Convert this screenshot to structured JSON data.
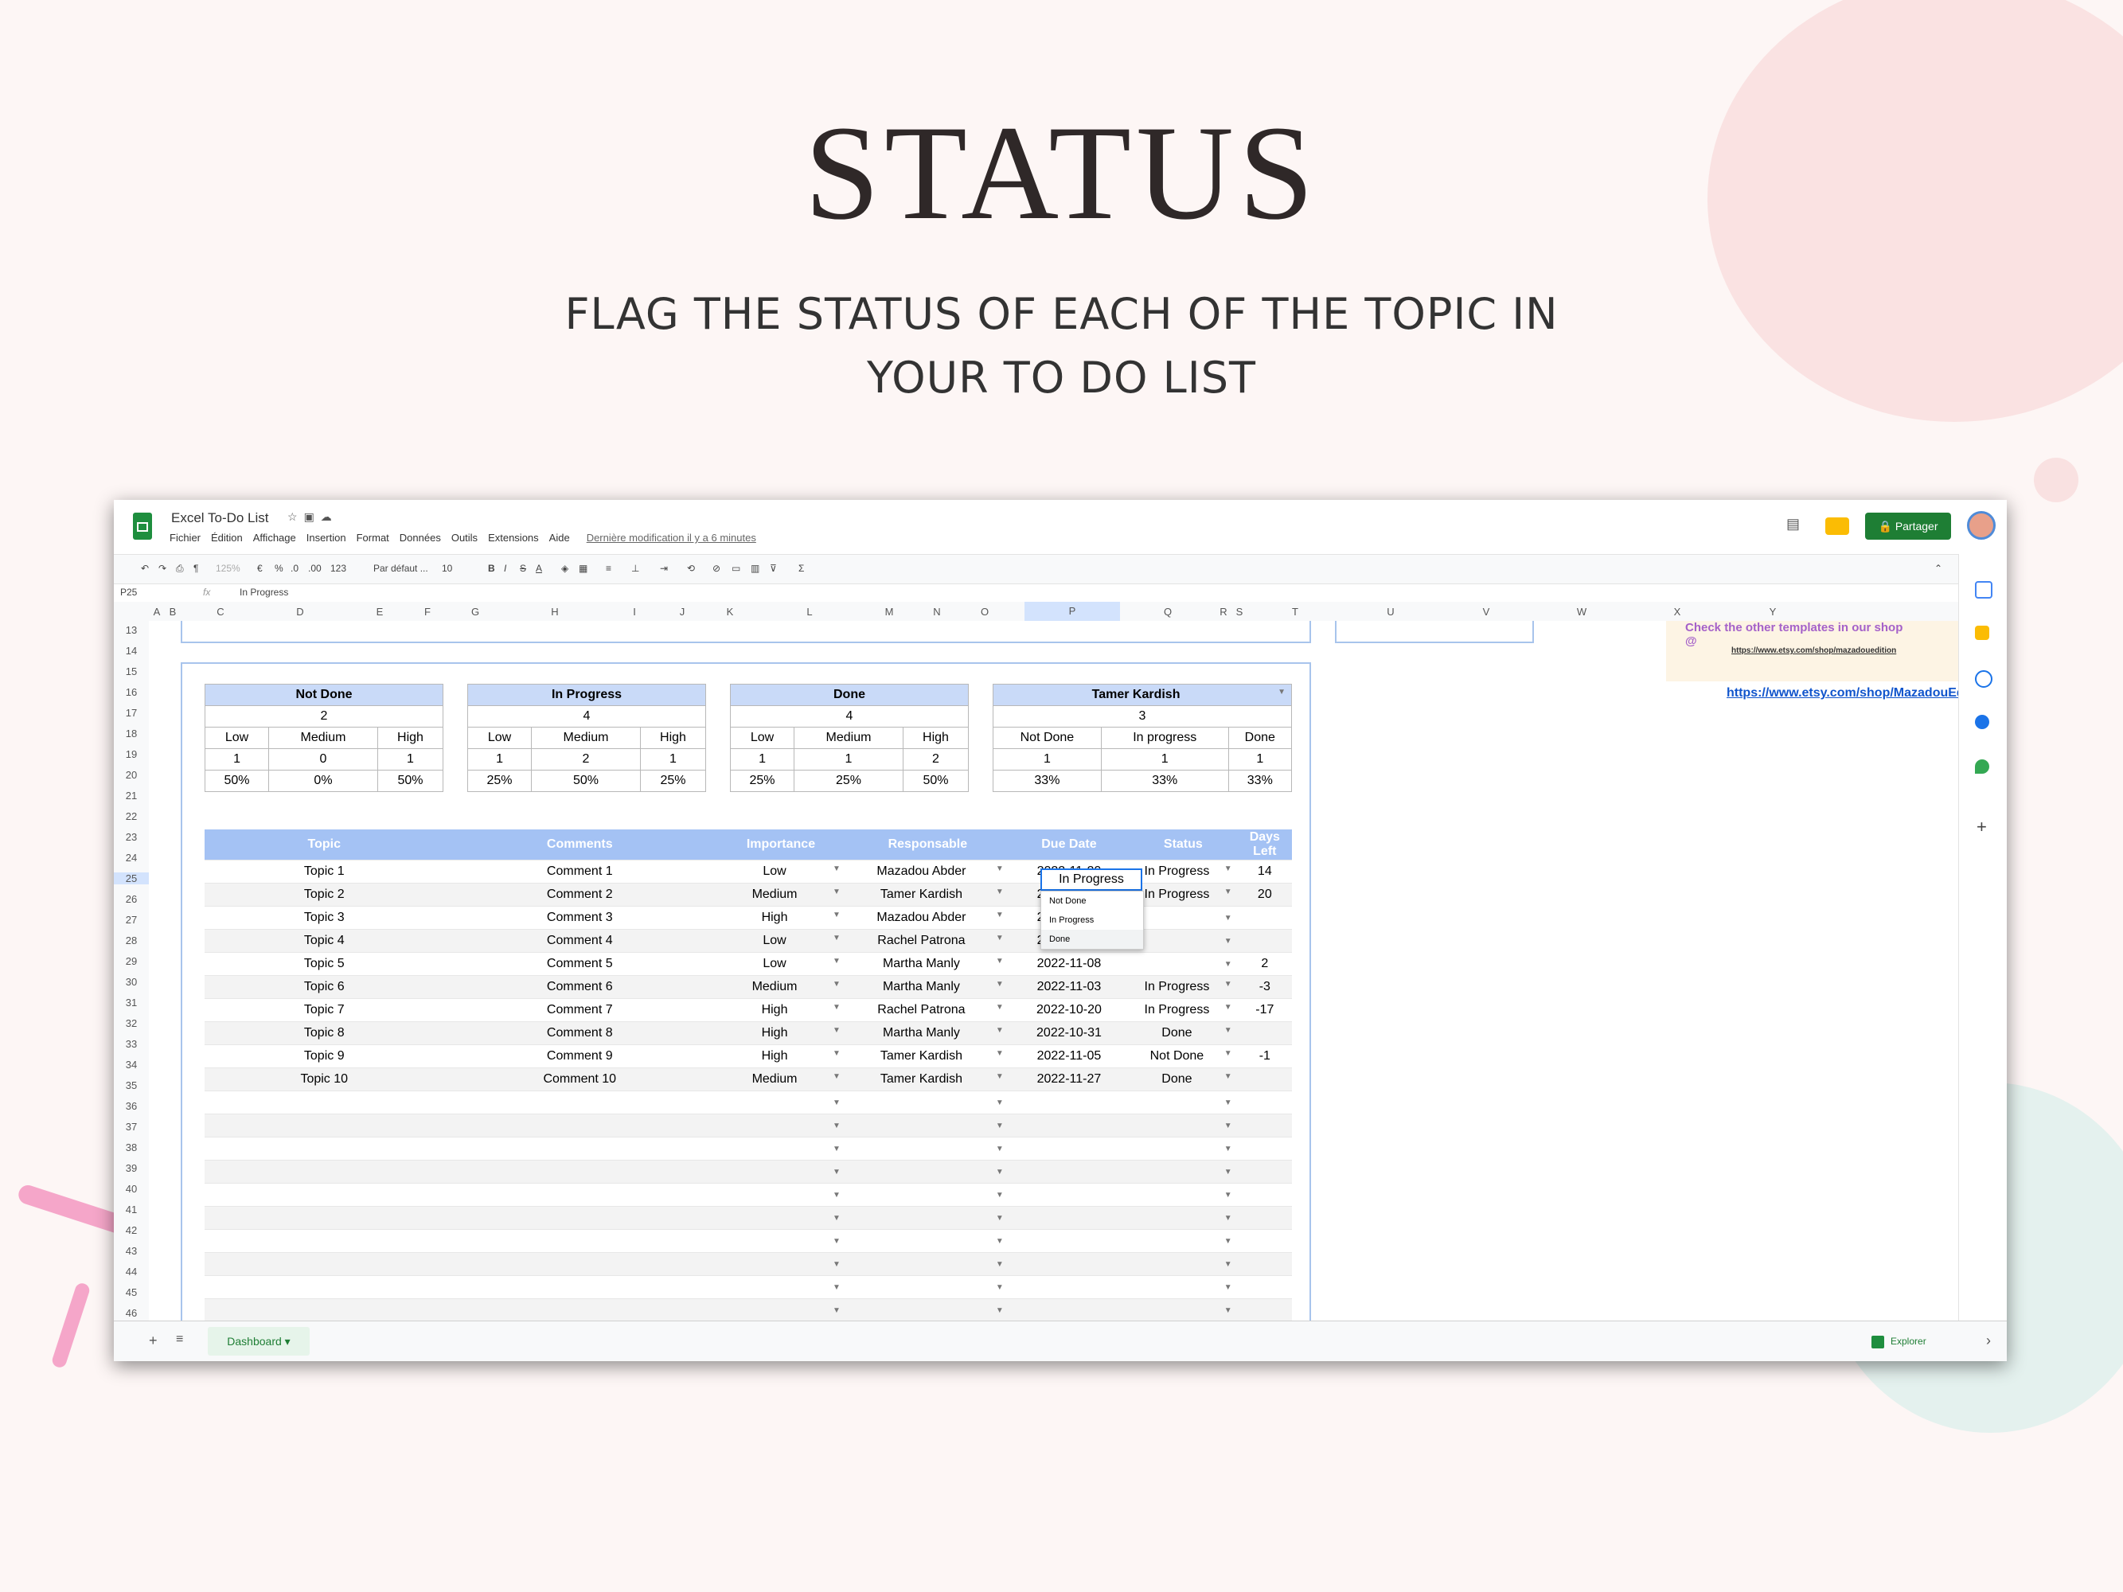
{
  "hero": {
    "title": "STATUS",
    "subtitle_line1": "FLAG THE STATUS OF EACH OF THE TOPIC IN",
    "subtitle_line2": "YOUR TO DO LIST"
  },
  "app": {
    "doc_title": "Excel To-Do List",
    "menu": [
      "Fichier",
      "Édition",
      "Affichage",
      "Insertion",
      "Format",
      "Données",
      "Outils",
      "Extensions",
      "Aide"
    ],
    "last_modified": "Dernière modification il y a 6 minutes",
    "share_label": "Partager",
    "cell_ref": "P25",
    "fx": "fx",
    "formula_value": "In Progress",
    "toolbar": {
      "zoom": "125%",
      "euro": "€",
      "percent": "%",
      "dec_less": ".0",
      "dec_more": ".00",
      "num_format": "123",
      "font": "Par défaut ...",
      "size": "10",
      "bold": "B",
      "italic": "I",
      "strike": "S",
      "text_color": "A"
    },
    "sheet_tab": "Dashboard",
    "explorer": "Explorer"
  },
  "columns": [
    "A",
    "B",
    "C",
    "D",
    "E",
    "F",
    "G",
    "H",
    "I",
    "J",
    "K",
    "L",
    "M",
    "N",
    "O",
    "P",
    "Q",
    "R",
    "S",
    "T",
    "U",
    "V",
    "W",
    "X",
    "Y"
  ],
  "rows": [
    "13",
    "14",
    "15",
    "16",
    "17",
    "18",
    "19",
    "20",
    "21",
    "22",
    "23",
    "24",
    "25",
    "26",
    "27",
    "28",
    "29",
    "30",
    "31",
    "32",
    "33",
    "34",
    "35",
    "36",
    "37",
    "38",
    "39",
    "40",
    "41",
    "42",
    "43",
    "44",
    "45",
    "46"
  ],
  "summary": [
    {
      "title": "Not Done",
      "total": "2",
      "labels": [
        "Low",
        "Medium",
        "High"
      ],
      "counts": [
        "1",
        "0",
        "1"
      ],
      "pcts": [
        "50%",
        "0%",
        "50%"
      ]
    },
    {
      "title": "In Progress",
      "total": "4",
      "labels": [
        "Low",
        "Medium",
        "High"
      ],
      "counts": [
        "1",
        "2",
        "1"
      ],
      "pcts": [
        "25%",
        "50%",
        "25%"
      ]
    },
    {
      "title": "Done",
      "total": "4",
      "labels": [
        "Low",
        "Medium",
        "High"
      ],
      "counts": [
        "1",
        "1",
        "2"
      ],
      "pcts": [
        "25%",
        "25%",
        "50%"
      ]
    },
    {
      "title": "Tamer Kardish",
      "total": "3",
      "labels": [
        "Not Done",
        "In progress",
        "Done"
      ],
      "counts": [
        "1",
        "1",
        "1"
      ],
      "pcts": [
        "33%",
        "33%",
        "33%"
      ]
    }
  ],
  "todo": {
    "headers": [
      "Topic",
      "Comments",
      "Importance",
      "Responsable",
      "Due Date",
      "Status",
      "Days Left"
    ],
    "rows": [
      [
        "Topic 1",
        "Comment 1",
        "Low",
        "Mazadou Abder",
        "2022-11-20",
        "In Progress",
        "14"
      ],
      [
        "Topic 2",
        "Comment 2",
        "Medium",
        "Tamer Kardish",
        "2022-11-26",
        "In Progress",
        "20"
      ],
      [
        "Topic 3",
        "Comment 3",
        "High",
        "Mazadou Abder",
        "2022-11-17",
        "",
        ""
      ],
      [
        "Topic 4",
        "Comment 4",
        "Low",
        "Rachel Patrona",
        "2022-11-26",
        "",
        ""
      ],
      [
        "Topic 5",
        "Comment 5",
        "Low",
        "Martha Manly",
        "2022-11-08",
        "",
        "2"
      ],
      [
        "Topic 6",
        "Comment 6",
        "Medium",
        "Martha Manly",
        "2022-11-03",
        "In Progress",
        "-3"
      ],
      [
        "Topic 7",
        "Comment 7",
        "High",
        "Rachel Patrona",
        "2022-10-20",
        "In Progress",
        "-17"
      ],
      [
        "Topic 8",
        "Comment 8",
        "High",
        "Martha Manly",
        "2022-10-31",
        "Done",
        ""
      ],
      [
        "Topic 9",
        "Comment 9",
        "High",
        "Tamer Kardish",
        "2022-11-05",
        "Not Done",
        "-1"
      ],
      [
        "Topic 10",
        "Comment 10",
        "Medium",
        "Tamer Kardish",
        "2022-11-27",
        "Done",
        ""
      ]
    ]
  },
  "dropdown": {
    "options": [
      "Not Done",
      "In Progress",
      "Done"
    ]
  },
  "promo": {
    "text": "Check the other templates in our shop @",
    "small_link": "https://www.etsy.com/shop/mazadouedition",
    "link": "https://www.etsy.com/shop/MazadouEditio"
  }
}
